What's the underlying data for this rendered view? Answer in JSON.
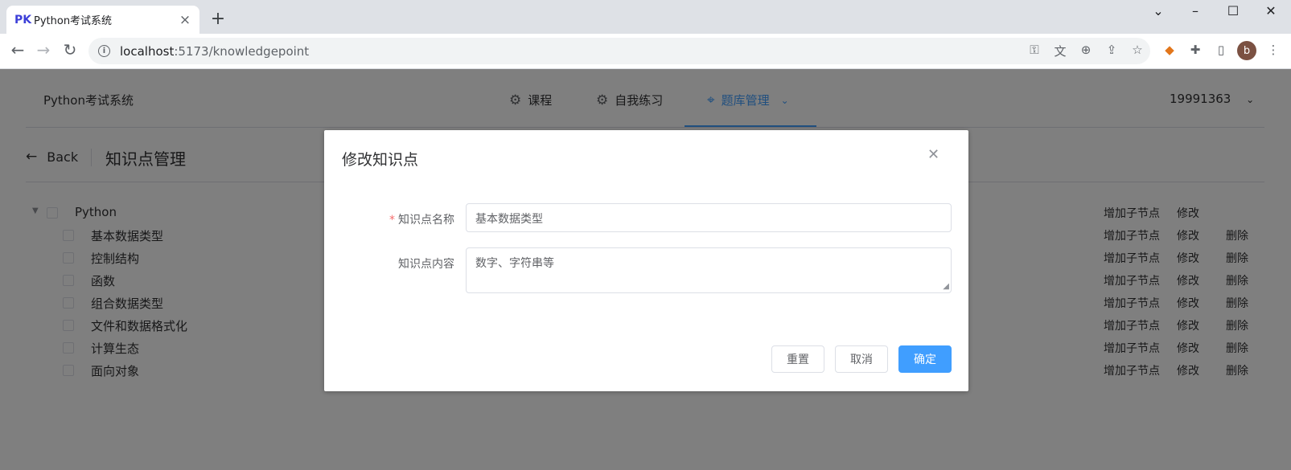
{
  "browser": {
    "tab_favicon": "PK",
    "tab_title": "Python考试系统",
    "url_host": "localhost",
    "url_path": ":5173/knowledgepoint",
    "avatar_letter": "b"
  },
  "header": {
    "brand": "Python考试系统",
    "menu": [
      {
        "label": "课程",
        "icon": "gear-icon"
      },
      {
        "label": "自我练习",
        "icon": "gear-icon"
      },
      {
        "label": "题库管理",
        "icon": "location-icon"
      }
    ],
    "user": "19991363"
  },
  "page": {
    "back_label": "Back",
    "title": "知识点管理"
  },
  "tree": {
    "root": {
      "label": "Python",
      "actions": [
        "增加子节点",
        "修改"
      ]
    },
    "children": [
      {
        "label": "基本数据类型",
        "actions": [
          "增加子节点",
          "修改",
          "删除"
        ]
      },
      {
        "label": "控制结构",
        "actions": [
          "增加子节点",
          "修改",
          "删除"
        ]
      },
      {
        "label": "函数",
        "actions": [
          "增加子节点",
          "修改",
          "删除"
        ]
      },
      {
        "label": "组合数据类型",
        "actions": [
          "增加子节点",
          "修改",
          "删除"
        ]
      },
      {
        "label": "文件和数据格式化",
        "actions": [
          "增加子节点",
          "修改",
          "删除"
        ]
      },
      {
        "label": "计算生态",
        "actions": [
          "增加子节点",
          "修改",
          "删除"
        ]
      },
      {
        "label": "面向对象",
        "actions": [
          "增加子节点",
          "修改",
          "删除"
        ]
      }
    ]
  },
  "dialog": {
    "title": "修改知识点",
    "name_label": "知识点名称",
    "name_value": "基本数据类型",
    "content_label": "知识点内容",
    "content_value": "数字、字符串等",
    "reset_label": "重置",
    "cancel_label": "取消",
    "confirm_label": "确定"
  },
  "colors": {
    "primary": "#409eff",
    "required": "#f56c6c",
    "overlay": "rgba(0,0,0,0.5)"
  }
}
